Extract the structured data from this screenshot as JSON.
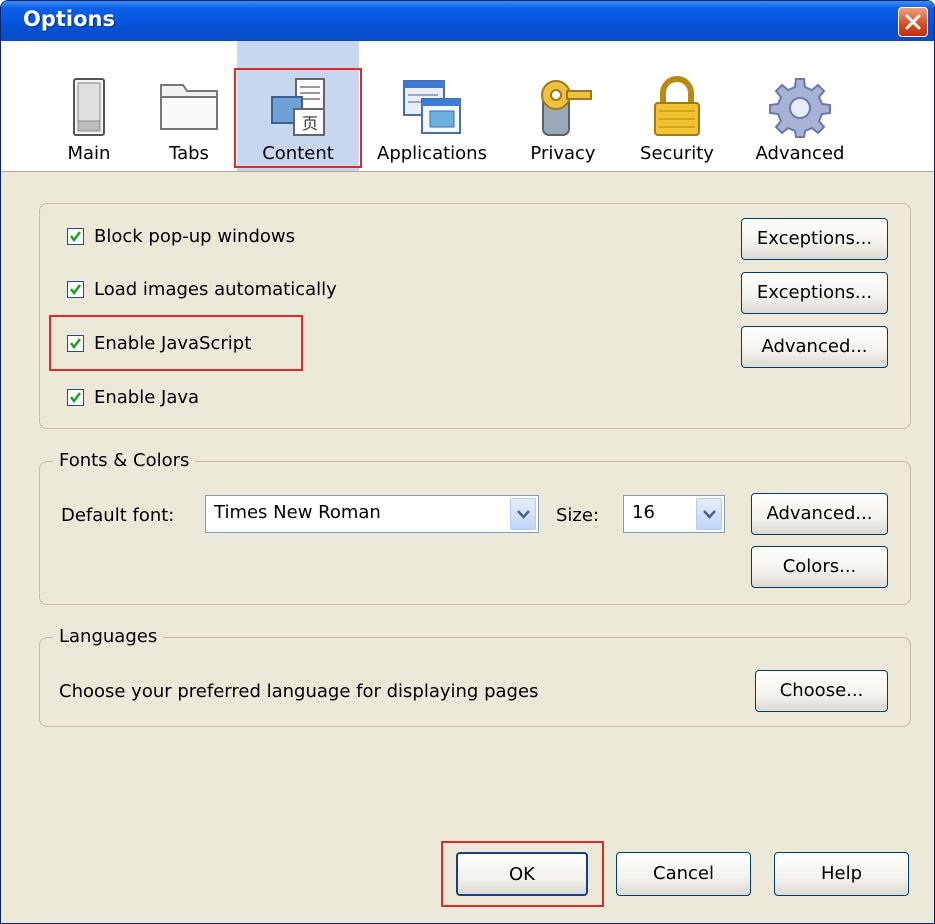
{
  "window": {
    "title": "Options"
  },
  "toolbar": {
    "items": [
      {
        "label": "Main",
        "icon": "main-switch-icon"
      },
      {
        "label": "Tabs",
        "icon": "tabs-folder-icon"
      },
      {
        "label": "Content",
        "icon": "content-page-icon",
        "selected": true
      },
      {
        "label": "Applications",
        "icon": "applications-window-icon"
      },
      {
        "label": "Privacy",
        "icon": "privacy-key-icon"
      },
      {
        "label": "Security",
        "icon": "security-lock-icon"
      },
      {
        "label": "Advanced",
        "icon": "advanced-gear-icon"
      }
    ]
  },
  "content": {
    "options": [
      {
        "label": "Block pop-up windows",
        "checked": true,
        "button": "Exceptions..."
      },
      {
        "label": "Load images automatically",
        "checked": true,
        "button": "Exceptions..."
      },
      {
        "label": "Enable JavaScript",
        "checked": true,
        "button": "Advanced..."
      },
      {
        "label": "Enable Java",
        "checked": true
      }
    ]
  },
  "fonts": {
    "legend": "Fonts & Colors",
    "default_font_label": "Default font:",
    "default_font_value": "Times New Roman",
    "size_label": "Size:",
    "size_value": "16",
    "advanced_button": "Advanced...",
    "colors_button": "Colors..."
  },
  "languages": {
    "legend": "Languages",
    "description": "Choose your preferred language for displaying pages",
    "choose_button": "Choose..."
  },
  "footer": {
    "ok": "OK",
    "cancel": "Cancel",
    "help": "Help"
  },
  "colors": {
    "titlebar": "#0553d9",
    "dialog_bg": "#ece9d8",
    "selected_tab_bg": "#c7d7ef",
    "highlight_box": "#e32828",
    "check": "#21a121"
  }
}
